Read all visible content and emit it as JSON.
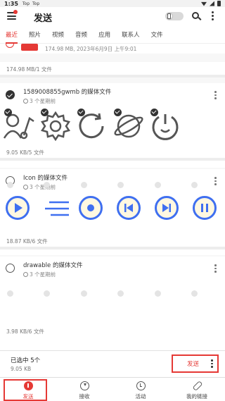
{
  "status_bar": {
    "time": "1:35",
    "apps": [
      "Top",
      "Top"
    ]
  },
  "app_bar": {
    "title": "发送"
  },
  "tabs": [
    "最近",
    "照片",
    "视频",
    "音频",
    "应用",
    "联系人",
    "文件"
  ],
  "content": {
    "prev_item": {
      "info": "174.98 MB, 2023年6月9日 上午9:01"
    },
    "prev_size": "174.98 MB/1 文件",
    "groups": [
      {
        "title": "1589008855gwmb 的媒体文件",
        "time": "3 个星期前",
        "size": "9.05 KB/5 文件",
        "checked": true
      },
      {
        "title": "Icon 的媒体文件",
        "time": "3 个星期前",
        "size": "18.87 KB/6 文件",
        "checked": false
      },
      {
        "title": "drawable 的媒体文件",
        "time": "3 个星期前",
        "size": "3.98 KB/6 文件",
        "checked": false
      }
    ]
  },
  "selection": {
    "title": "已选中 5个",
    "size": "9.05 KB",
    "send_label": "发送"
  },
  "bottom_nav": [
    {
      "label": "发送",
      "icon": "upload-icon",
      "active": true
    },
    {
      "label": "接收",
      "icon": "download-icon",
      "active": false
    },
    {
      "label": "活动",
      "icon": "clock-icon",
      "active": false
    },
    {
      "label": "我的链接",
      "icon": "link-icon",
      "active": false
    }
  ],
  "colors": {
    "accent": "#e53935",
    "blue": "#3f6ff0"
  }
}
